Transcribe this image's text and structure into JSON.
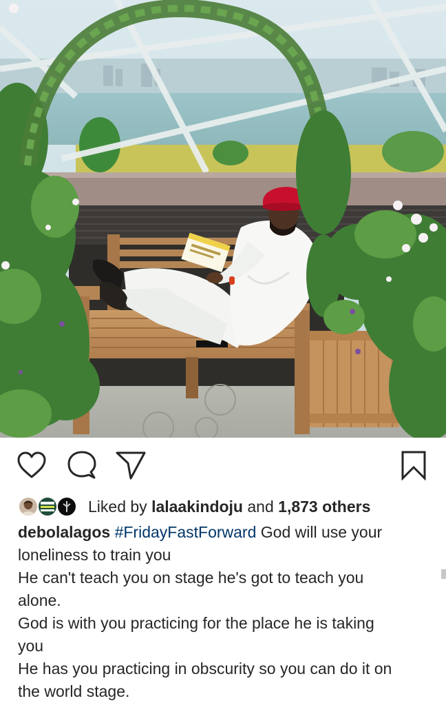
{
  "post": {
    "image_alt": "Man in white attire and red cap reading a book on a wooden bench under a floral arch",
    "book_title": "Don't Stop Believing"
  },
  "actions": {
    "like_icon": "heart-outline-icon",
    "comment_icon": "comment-bubble-icon",
    "share_icon": "paper-plane-icon",
    "save_icon": "bookmark-outline-icon"
  },
  "likes": {
    "prefix": "Liked by ",
    "user": "lalaakindoju",
    "and": " and ",
    "count": "1,873 others"
  },
  "caption": {
    "username": "debolalagos",
    "hashtag": "#FridayFastForward",
    "line1_rest": " God will use your",
    "line2": "loneliness to train you",
    "line3": "He can't teach you on stage he's got to teach you",
    "line4": "alone.",
    "line5": "God is with you practicing for the place he is taking",
    "line6": "you",
    "line7": "He has you practicing in obscurity so you can do it on",
    "line8": "the world stage."
  },
  "colors": {
    "text": "#262626",
    "hashtag": "#003569",
    "cap": "#c8102e"
  }
}
